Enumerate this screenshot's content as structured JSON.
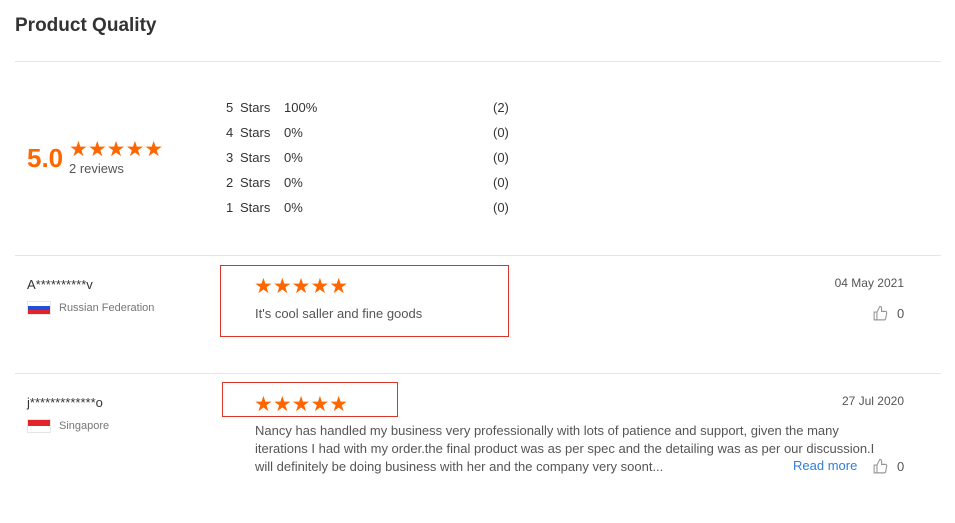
{
  "section": {
    "title": "Product Quality"
  },
  "summary": {
    "score": "5.0",
    "stars_rating": 5,
    "stars_glyph": "★★★★★",
    "reviews_label": "2 reviews"
  },
  "distribution": [
    {
      "stars": "5",
      "label": "Stars",
      "percent": "100%",
      "count": "(2)"
    },
    {
      "stars": "4",
      "label": "Stars",
      "percent": "0%",
      "count": "(0)"
    },
    {
      "stars": "3",
      "label": "Stars",
      "percent": "0%",
      "count": "(0)"
    },
    {
      "stars": "2",
      "label": "Stars",
      "percent": "0%",
      "count": "(0)"
    },
    {
      "stars": "1",
      "label": "Stars",
      "percent": "0%",
      "count": "(0)"
    }
  ],
  "reviews": [
    {
      "name": "A**********v",
      "country": "Russian Federation",
      "flag_icon": "russia-flag-icon",
      "rating": 5,
      "stars_glyph": "★★★★★",
      "text": "It's cool saller and fine goods",
      "date": "04 May 2021",
      "likes": "0"
    },
    {
      "name": "j*************o",
      "country": "Singapore",
      "flag_icon": "singapore-flag-icon",
      "rating": 5,
      "stars_glyph": "★★★★★",
      "text": "Nancy has handled my business very professionally with lots of patience and support, given the many iterations I had with my order.the final product was as per spec and the detailing was as per our discussion.I will definitely be doing business with her and the company very soont...",
      "read_more": "Read more",
      "date": "27 Jul 2020",
      "likes": "0"
    }
  ],
  "colors": {
    "accent": "#ff6600",
    "highlight_border": "#d9362b",
    "link": "#2f7ed8",
    "divider": "#e6e6e6"
  }
}
